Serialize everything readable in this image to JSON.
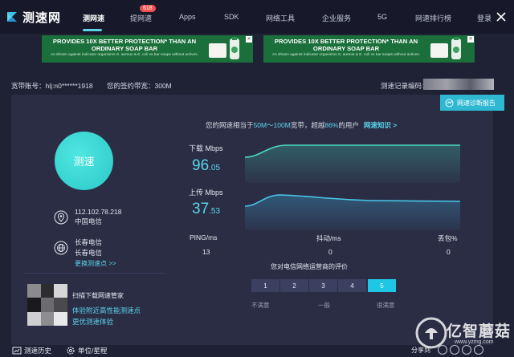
{
  "brand": {
    "name": "测速网"
  },
  "nav": {
    "items": [
      {
        "label": "测网速",
        "active": true
      },
      {
        "label": "提网速",
        "badge": "618"
      },
      {
        "label": "Apps"
      },
      {
        "label": "SDK"
      },
      {
        "label": "网络工具"
      },
      {
        "label": "企业服务"
      },
      {
        "label": "5G"
      },
      {
        "label": "网速排行榜"
      },
      {
        "label": "登录"
      }
    ]
  },
  "ads": [
    {
      "title": "PROVIDES 10X BETTER PROTECTION* THAN AN ORDINARY SOAP BAR",
      "subtitle": "As shown against indicator organisms S. aureus & E. coli vs bar soaps without actives."
    },
    {
      "title": "PROVIDES 10X BETTER PROTECTION* THAN AN ORDINARY SOAP BAR",
      "subtitle": "As shown against indicator organisms S. aureus & E. coli vs bar soaps without actives."
    }
  ],
  "account": {
    "broadband_label": "宽带账号：hlj:n0******1918",
    "contract_label": "您的签约带宽：300M",
    "record_label": "测速记录编码："
  },
  "diagnose_button": "网速诊断报告",
  "speed_button": "测速",
  "side": {
    "ip": "112.102.78.218",
    "ip_isp": "中国电信",
    "server_line1": "长春电信",
    "server_line2": "长春电信",
    "change_server": "更换测速点 >>",
    "qr_title": "扫描下载网速管家",
    "qr_line1": "体验附近高性能测速点",
    "qr_line2": "更优测速体验"
  },
  "summary": {
    "prefix": "您的网速相当于",
    "range": "50M～100M",
    "middle": "宽带，超越",
    "percent": "86%",
    "suffix": "的用户",
    "link": "网速知识 >"
  },
  "download": {
    "label": "下载 Mbps",
    "int": "96",
    "dec": ".05"
  },
  "upload": {
    "label": "上传 Mbps",
    "int": "37",
    "dec": ".53"
  },
  "stats": [
    {
      "label": "PING/ms",
      "value": "13"
    },
    {
      "label": "抖动/ms",
      "value": "0"
    },
    {
      "label": "丢包%",
      "value": "0"
    }
  ],
  "rating": {
    "title": "您对电信网络运营商的评价",
    "options": [
      "1",
      "2",
      "3",
      "4",
      "5"
    ],
    "selected": "5",
    "low": "不满意",
    "mid": "一般",
    "high": "很满意"
  },
  "footer": {
    "history": "测速历史",
    "units": "单位/星程",
    "share": "分享到"
  },
  "watermark": {
    "name": "亿智蘑菇",
    "url": "www.yzmg.com"
  },
  "colors": {
    "accent": "#5ad5ea",
    "panel": "#2b2d45",
    "background": "#1f2135",
    "selected": "#1ec7e3"
  }
}
